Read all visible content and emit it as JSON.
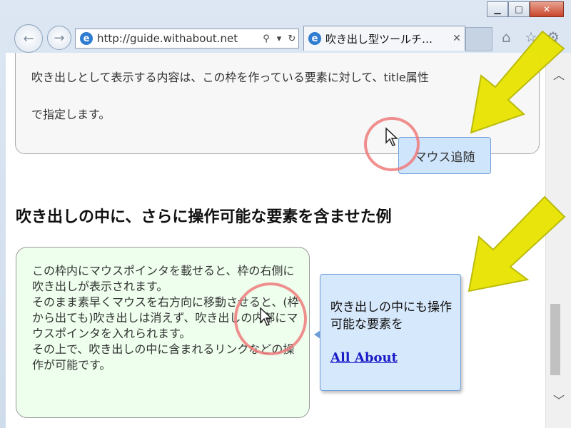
{
  "browser": {
    "url": "http://guide.withabout.net",
    "tab_title": "吹き出し型ツールチ…",
    "window_controls": {
      "minimize": "▁",
      "maximize": "□",
      "close": "✕"
    },
    "icons": [
      "back-icon",
      "forward-icon",
      "ie-icon",
      "search-icon",
      "dropdown-icon",
      "refresh-icon",
      "close-icon",
      "home-icon",
      "star-icon",
      "gear-icon"
    ]
  },
  "section1": {
    "line1": "吹き出しとして表示する内容は、この枠を作っている要素に対して、title属性",
    "line2": "で指定します。",
    "tooltip": "マウス追随"
  },
  "heading": "吹き出しの中に、さらに操作可能な要素を含ませた例",
  "section2": {
    "p1": "この枠内にマウスポインタを載せると、枠の右側に吹き出しが表示されます。",
    "p2": "そのまま素早くマウスを右方向に移動させると、(枠から出ても)吹き出しは消えず、吹き出しの内部にマウスポインタを入れられます。",
    "p3": "その上で、吹き出しの中に含まれるリンクなどの操作が可能です。",
    "tooltip_text": "吹き出しの中にも操作可能な要素を",
    "tooltip_link": "All About"
  },
  "colors": {
    "accent_ring": "#ef7b7b",
    "annotation_arrow": "#e8e400",
    "tooltip_bg": "#d6e8fb",
    "green_box": "#eeffee",
    "link": "#1b1bc8"
  }
}
